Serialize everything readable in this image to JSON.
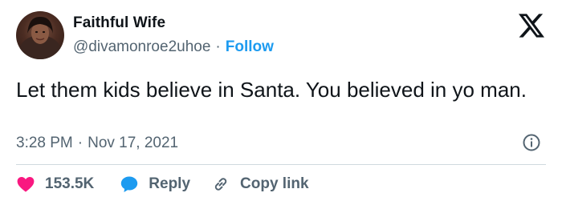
{
  "author": {
    "display_name": "Faithful Wife",
    "handle": "@divamonroe2uhoe",
    "separator": "·",
    "follow_label": "Follow"
  },
  "tweet": {
    "text": "Let them kids believe in Santa. You believed in yo man.",
    "time": "3:28 PM",
    "separator": "·",
    "date": "Nov 17, 2021"
  },
  "actions": {
    "like_count": "153.5K",
    "reply_label": "Reply",
    "copy_link_label": "Copy link"
  },
  "icons": {
    "brand": "x-logo-icon",
    "info": "info-icon",
    "like": "heart-icon",
    "reply": "speech-bubble-icon",
    "copy": "link-icon"
  },
  "colors": {
    "text": "#0f1419",
    "secondary": "#536471",
    "accent": "#1d9bf0",
    "like": "#f91880",
    "divider": "#cfd9de"
  }
}
